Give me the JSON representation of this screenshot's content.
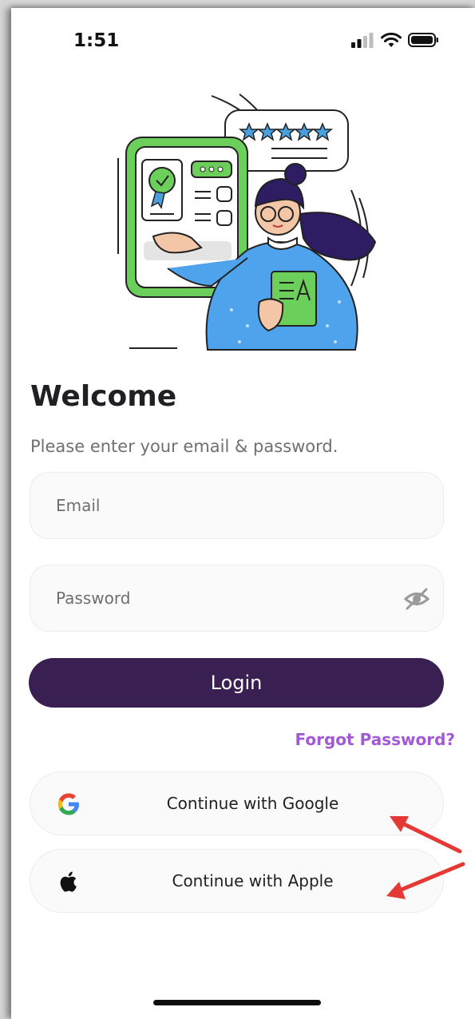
{
  "status_bar": {
    "time": "1:51"
  },
  "login": {
    "title": "Welcome",
    "subtitle": "Please enter your email & password.",
    "email_placeholder": "Email",
    "password_placeholder": "Password",
    "login_label": "Login",
    "forgot_label": "Forgot Password?",
    "google_label": "Continue with Google",
    "apple_label": "Continue with Apple"
  },
  "icons": {
    "signal": "cellular-signal-icon",
    "wifi": "wifi-icon",
    "battery": "battery-icon",
    "password_toggle": "eye-slash-icon",
    "google": "google-logo-icon",
    "apple": "apple-logo-icon"
  },
  "colors": {
    "primary": "#3a1f52",
    "accent": "#a259d6",
    "annotation_arrow": "#e53935"
  }
}
